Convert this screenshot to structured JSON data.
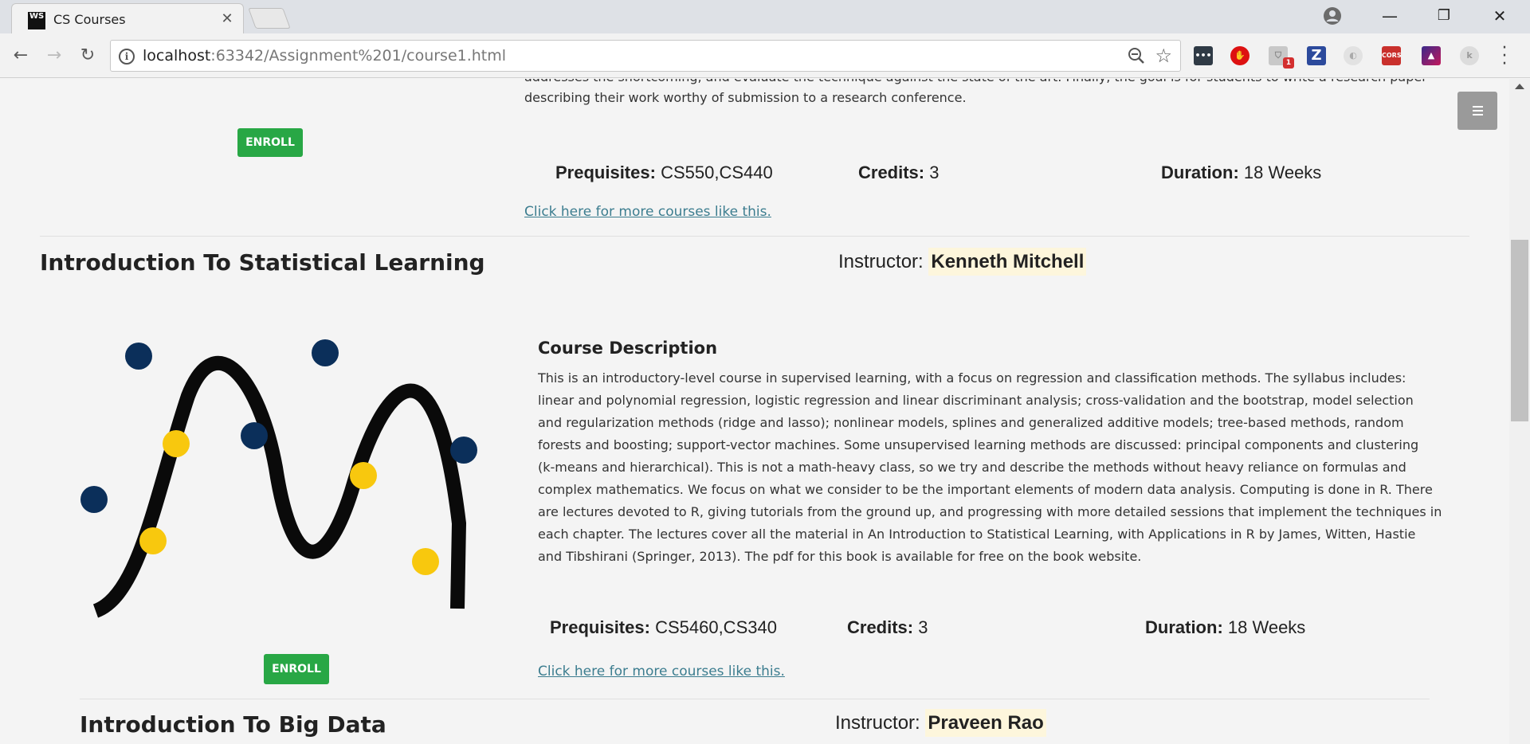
{
  "browser": {
    "tab_title": "CS Courses",
    "tab_logo": "WS",
    "url_host": "localhost",
    "url_rest": ":63342/Assignment%201/course1.html",
    "badge_count": "1",
    "ext_cors_label": "CORS",
    "ext_z_label": "Z"
  },
  "previous_course": {
    "desc_line1": "addresses the shortcoming, and evaluate the technique against the state of the art. Finally, the goal is for students to write a research paper",
    "desc_line2": "describing their work worthy of submission to a research conference.",
    "enroll_label": "ENROLL",
    "prereq_label": "Prequisites:",
    "prereq_value": "CS550,CS440",
    "credits_label": "Credits:",
    "credits_value": "3",
    "duration_label": "Duration:",
    "duration_value": "18 Weeks",
    "more_link": "Click here for more courses like this."
  },
  "course": {
    "title": "Introduction To Statistical Learning",
    "instructor_label": "Instructor:",
    "instructor_name": "Kenneth Mitchell",
    "description_heading": "Course Description",
    "description_lines": [
      "This is an introductory-level course in supervised learning, with a focus on regression and classification methods. The syllabus includes:",
      "linear and polynomial regression, logistic regression and linear discriminant analysis; cross-validation and the bootstrap, model selection",
      "and regularization methods (ridge and lasso); nonlinear models, splines and generalized additive models; tree-based methods, random",
      "forests and boosting; support-vector machines. Some unsupervised learning methods are discussed: principal components and clustering",
      "(k-means and hierarchical). This is not a math-heavy class, so we try and describe the methods without heavy reliance on formulas and",
      "complex mathematics. We focus on what we consider to be the important elements of modern data analysis. Computing is done in R. There",
      "are lectures devoted to R, giving tutorials from the ground up, and progressing with more detailed sessions that implement the techniques in",
      "each chapter. The lectures cover all the material in An Introduction to Statistical Learning, with Applications in R by James, Witten, Hastie",
      "and Tibshirani (Springer, 2013). The pdf for this book is available for free on the book website."
    ],
    "enroll_label": "ENROLL",
    "prereq_label": "Prequisites:",
    "prereq_value": "CS5460,CS340",
    "credits_label": "Credits:",
    "credits_value": "3",
    "duration_label": "Duration:",
    "duration_value": "18 Weeks",
    "more_link": "Click here for more courses like this."
  },
  "next_course": {
    "title": "Introduction To Big Data",
    "instructor_label": "Instructor:",
    "instructor_name": "Praveen Rao"
  },
  "colors": {
    "enroll_green": "#28a745",
    "link_teal": "#3c7d8f",
    "instructor_highlight": "#fdf6dc",
    "dot_navy": "#0b2f5a",
    "dot_yellow": "#f8c80e"
  }
}
